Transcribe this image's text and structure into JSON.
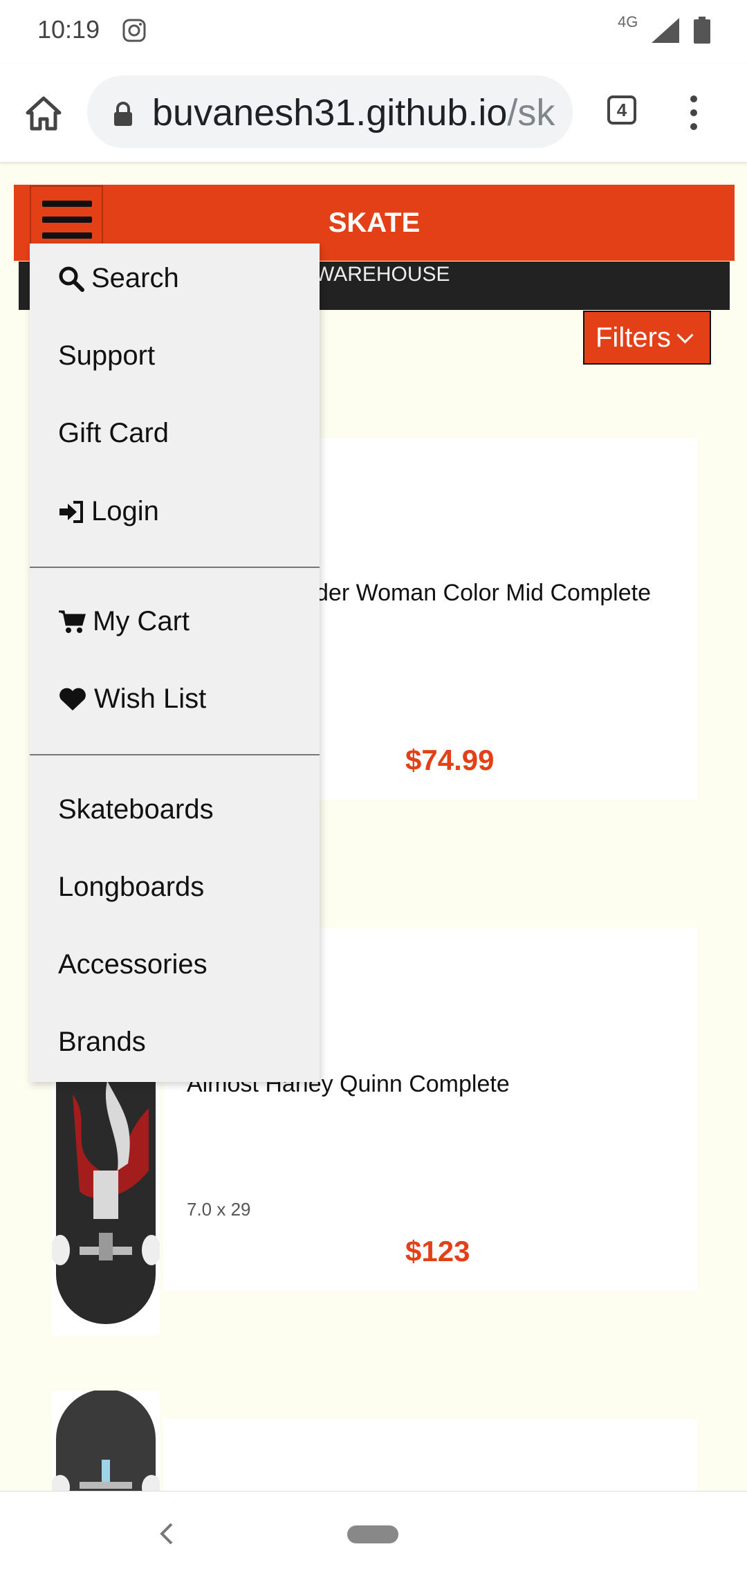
{
  "status_bar": {
    "time": "10:19",
    "network": "4G"
  },
  "browser": {
    "url_main": "buvanesh31.github.io",
    "url_rest": "/sk",
    "tab_count": "4"
  },
  "header": {
    "title": "SKATE",
    "subtitle": "WAREHOUSE",
    "filters_label": "Filters"
  },
  "menu": {
    "search": "Search",
    "support": "Support",
    "gift_card": "Gift Card",
    "login": "Login",
    "my_cart": "My Cart",
    "wish_list": "Wish List",
    "skateboards": "Skateboards",
    "longboards": "Longboards",
    "accessories": "Accessories",
    "brands": "Brands"
  },
  "products": [
    {
      "name": "der Woman Color Mid Complete",
      "price": "$74.99"
    },
    {
      "name": "Almost Harley Quinn Complete",
      "size": "7.0 x 29",
      "price": "$123"
    }
  ],
  "colors": {
    "accent": "#e34017",
    "page_bg": "#fdfdf0",
    "menu_bg": "#f0f0f0",
    "subheader_bg": "#222222"
  }
}
